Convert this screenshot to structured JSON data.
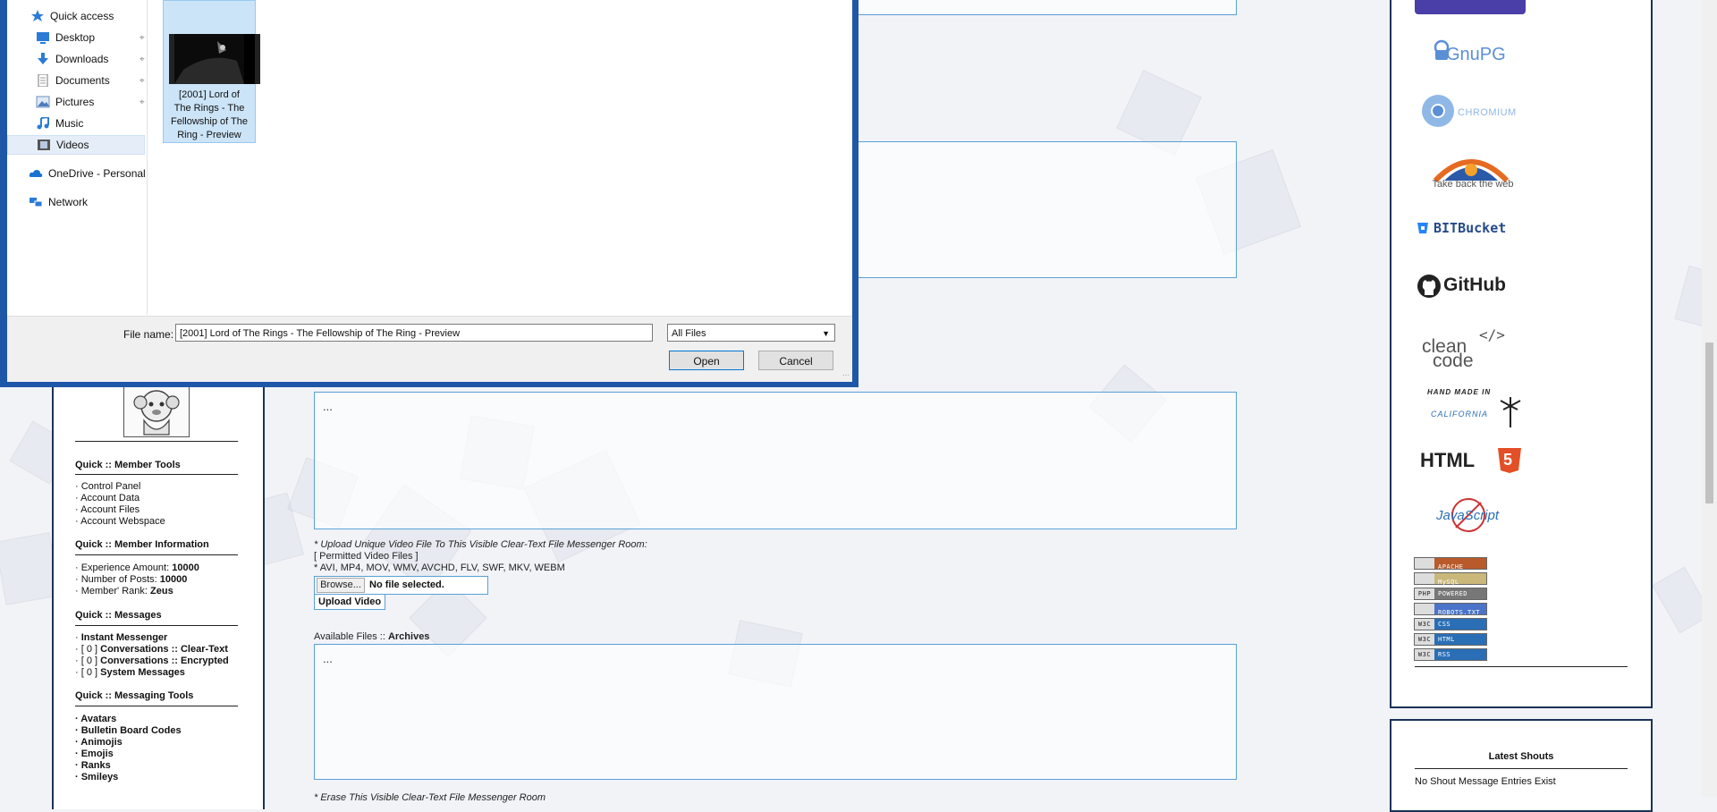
{
  "dialog": {
    "nav": [
      {
        "label": "Quick access",
        "icon": "star-icon",
        "pinned": false
      },
      {
        "label": "Desktop",
        "icon": "desktop-icon",
        "pinned": true
      },
      {
        "label": "Downloads",
        "icon": "download-icon",
        "pinned": true
      },
      {
        "label": "Documents",
        "icon": "documents-icon",
        "pinned": true
      },
      {
        "label": "Pictures",
        "icon": "pictures-icon",
        "pinned": true
      },
      {
        "label": "Music",
        "icon": "music-icon",
        "pinned": false
      },
      {
        "label": "Videos",
        "icon": "videos-icon",
        "pinned": false,
        "selected": true
      },
      {
        "label": "OneDrive - Personal",
        "icon": "cloud-icon",
        "pinned": false
      },
      {
        "label": "Network",
        "icon": "network-icon",
        "pinned": false
      }
    ],
    "file": {
      "caption_lines": [
        "[2001] Lord of",
        "The Rings - The",
        "Fellowship of The",
        "Ring - Preview"
      ]
    },
    "footer": {
      "file_name_label": "File name:",
      "file_name_value": "[2001] Lord of The Rings - The Fellowship of The Ring - Preview",
      "file_type_value": "All Files",
      "open_label": "Open",
      "cancel_label": "Cancel"
    }
  },
  "main": {
    "dots": "...",
    "upload": {
      "note": "* Upload Unique Video File To This Visible Clear-Text File Messenger Room:",
      "permitted": "[ Permitted Video Files ]",
      "types": "* AVI, MP4, MOV, WMV, AVCHD, FLV, SWF, MKV, WEBM",
      "browse_label": "Browse...",
      "no_file": "No file selected.",
      "upload_label": "Upload Video"
    },
    "available_prefix": "Available Files :: ",
    "available_bold": "Archives",
    "erase_note": "* Erase This Visible Clear-Text File Messenger Room"
  },
  "left": {
    "member_tools_title": "Quick :: Member Tools",
    "member_tools": [
      "· Control Panel",
      "· Account Data",
      "· Account Files",
      "· Account Webspace"
    ],
    "member_info_title": "Quick :: Member Information",
    "member_info": [
      {
        "label": "· Experience Amount: ",
        "value": "10000"
      },
      {
        "label": "· Number of Posts: ",
        "value": "10000"
      },
      {
        "label": "· Member' Rank: ",
        "value": "Zeus"
      }
    ],
    "messages_title": "Quick :: Messages",
    "messages": [
      {
        "prefix": "· ",
        "label": "Instant Messenger"
      },
      {
        "prefix": "· [ 0 ] ",
        "label": "Conversations :: Clear-Text"
      },
      {
        "prefix": "· [ 0 ] ",
        "label": "Conversations :: Encrypted"
      },
      {
        "prefix": "· [ 0 ] ",
        "label": "System Messages"
      }
    ],
    "messaging_tools_title": "Quick :: Messaging Tools",
    "messaging_tools": [
      "· Avatars",
      "· Bulletin Board Codes",
      "· Animojis",
      "· Emojis",
      "· Ranks",
      "· Smileys"
    ]
  },
  "right": {
    "logos": {
      "gnupg": "GnuPG",
      "chromium": "CHROMIUM",
      "firefox": "Take back the web",
      "bitbucket": "BITBucket",
      "github": "GitHub",
      "cleancode_1": "clean",
      "cleancode_2": "code",
      "handmade_1": "HAND MADE IN",
      "handmade_2": "CALIFORNIA",
      "html5": "HTML",
      "html5_num": "5",
      "javascript": "JavaScript"
    },
    "badges": [
      {
        "left": "",
        "right": "APACHE",
        "color": "#b85a2a"
      },
      {
        "left": "",
        "right": "MySQL",
        "color": "#c9b87a"
      },
      {
        "left": "PHP",
        "right": "POWERED",
        "color": "#777"
      },
      {
        "left": "",
        "right": "ROBOTS.TXT",
        "color": "#4a74c9"
      },
      {
        "left": "W3C",
        "right": "CSS",
        "color": "#2a6fb5"
      },
      {
        "left": "W3C",
        "right": "HTML",
        "color": "#2a6fb5"
      },
      {
        "left": "W3C",
        "right": "RSS",
        "color": "#2a6fb5"
      }
    ],
    "shouts_title": "Latest Shouts",
    "shouts_msg": "No Shout Message Entries Exist"
  }
}
